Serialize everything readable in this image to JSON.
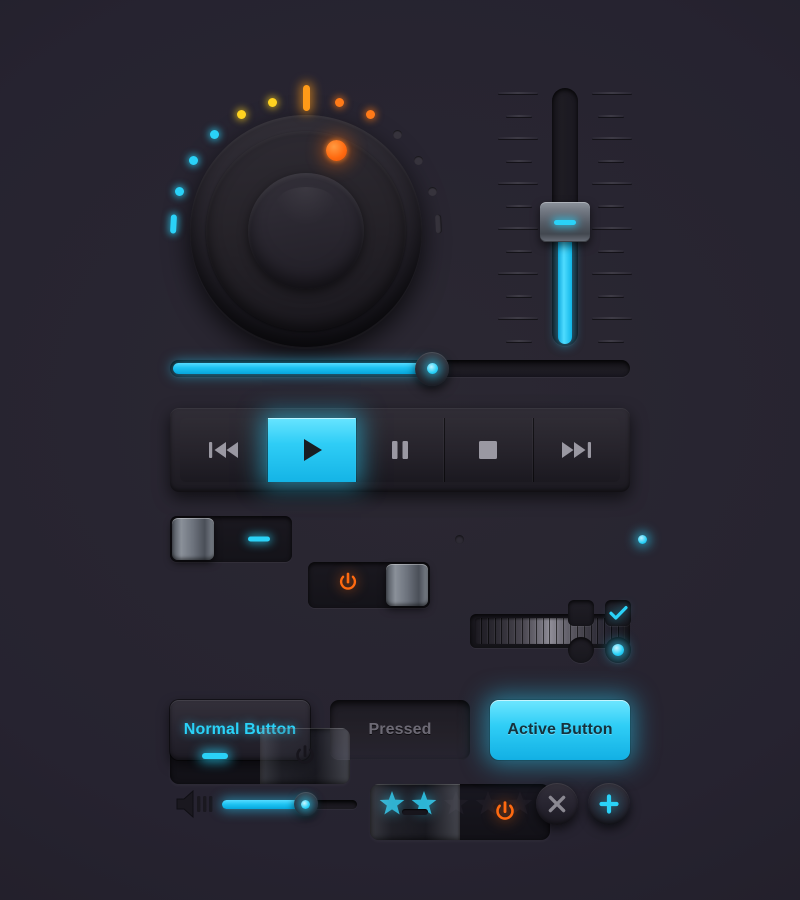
{
  "theme": {
    "background": "#242029",
    "panel": "#2a272f",
    "accent_cyan": "#2ad2f8",
    "accent_orange": "#ff6a10",
    "accent_yellow": "#ffd320",
    "text_muted": "#6d6a75"
  },
  "rotary_knob": {
    "name": "Rotary Knob",
    "value_percent": 62,
    "pointer_color": "#ff6a10",
    "leds": [
      {
        "state": "on",
        "color": "cyan",
        "shape": "dash"
      },
      {
        "state": "on",
        "color": "cyan",
        "shape": "dot"
      },
      {
        "state": "on",
        "color": "cyan",
        "shape": "dot"
      },
      {
        "state": "on",
        "color": "cyan",
        "shape": "dot"
      },
      {
        "state": "on",
        "color": "yellow",
        "shape": "dot"
      },
      {
        "state": "on",
        "color": "yellow",
        "shape": "dot"
      },
      {
        "state": "on",
        "color": "orange",
        "shape": "bar"
      },
      {
        "state": "on",
        "color": "orange",
        "shape": "dot"
      },
      {
        "state": "on",
        "color": "orange",
        "shape": "dot"
      },
      {
        "state": "off",
        "color": "off",
        "shape": "dot"
      },
      {
        "state": "off",
        "color": "off",
        "shape": "dot"
      },
      {
        "state": "off",
        "color": "off",
        "shape": "dot"
      },
      {
        "state": "off",
        "color": "off",
        "shape": "dash"
      }
    ]
  },
  "vertical_fader": {
    "name": "Vertical Fader",
    "value_percent": 48,
    "handle_mark": "minus-dash",
    "fill_color": "#2ad2f8",
    "tick_count": 12
  },
  "progress_slider": {
    "name": "Progress Slider",
    "value_percent": 57,
    "fill_color": "#2ad2f8"
  },
  "transport": {
    "buttons": [
      {
        "id": "previous",
        "icon": "skip-back-icon",
        "label": "Previous",
        "active": false
      },
      {
        "id": "play",
        "icon": "play-icon",
        "label": "Play",
        "active": true
      },
      {
        "id": "pause",
        "icon": "pause-icon",
        "label": "Pause",
        "active": false
      },
      {
        "id": "stop",
        "icon": "stop-icon",
        "label": "Stop",
        "active": false
      },
      {
        "id": "next",
        "icon": "skip-forward-icon",
        "label": "Next",
        "active": false
      }
    ]
  },
  "small_toggles": [
    {
      "id": "toggle-cyan",
      "handle_position": "left",
      "indicator": "minus-dash",
      "indicator_color": "#2ad2f8",
      "state": "off"
    },
    {
      "id": "toggle-orange",
      "handle_position": "right",
      "indicator": "power-icon",
      "indicator_color": "#ff6a10",
      "state": "on"
    }
  ],
  "scroll_wheel": {
    "name": "Ribbed Scroll Wheel",
    "rib_count": 22,
    "left_dot": "off",
    "right_dot": "on"
  },
  "rockers": [
    {
      "id": "rocker-cyan",
      "handle_side": "right",
      "left_symbol": "minus-dash",
      "left_color": "#2ad2f8",
      "left_lit": true,
      "right_symbol": "power-icon",
      "right_color": "#191720",
      "right_lit": false
    },
    {
      "id": "rocker-orange",
      "handle_side": "left",
      "left_symbol": "minus-dash",
      "left_color": "#1c1a22",
      "left_lit": false,
      "right_symbol": "power-icon",
      "right_color": "#ff6a10",
      "right_lit": true
    }
  ],
  "selection_controls": {
    "checkbox_unchecked": {
      "id": "checkbox-off",
      "checked": false
    },
    "checkbox_checked": {
      "id": "checkbox-on",
      "checked": true,
      "mark_color": "#2ad2f8"
    },
    "radio_unselected": {
      "id": "radio-off",
      "selected": false
    },
    "radio_selected": {
      "id": "radio-on",
      "selected": true,
      "dot_color": "#2ad2f8"
    }
  },
  "buttons": [
    {
      "id": "normal",
      "label": "Normal Button",
      "state": "normal"
    },
    {
      "id": "pressed",
      "label": "Pressed",
      "state": "pressed"
    },
    {
      "id": "active",
      "label": "Active Button",
      "state": "active"
    }
  ],
  "volume": {
    "name": "Volume Slider",
    "icon": "speaker-icon",
    "value_percent": 62,
    "fill_color": "#2ad2f8"
  },
  "rating": {
    "name": "Star Rating",
    "value": 2,
    "max": 5,
    "filled_color": "#2ad2f8",
    "empty_color": "#1d1b24"
  },
  "action_buttons": [
    {
      "id": "close",
      "icon": "close-icon",
      "label": "Close",
      "color": "#8b8992"
    },
    {
      "id": "add",
      "icon": "plus-icon",
      "label": "Add",
      "color": "#2ad2f8"
    }
  ]
}
